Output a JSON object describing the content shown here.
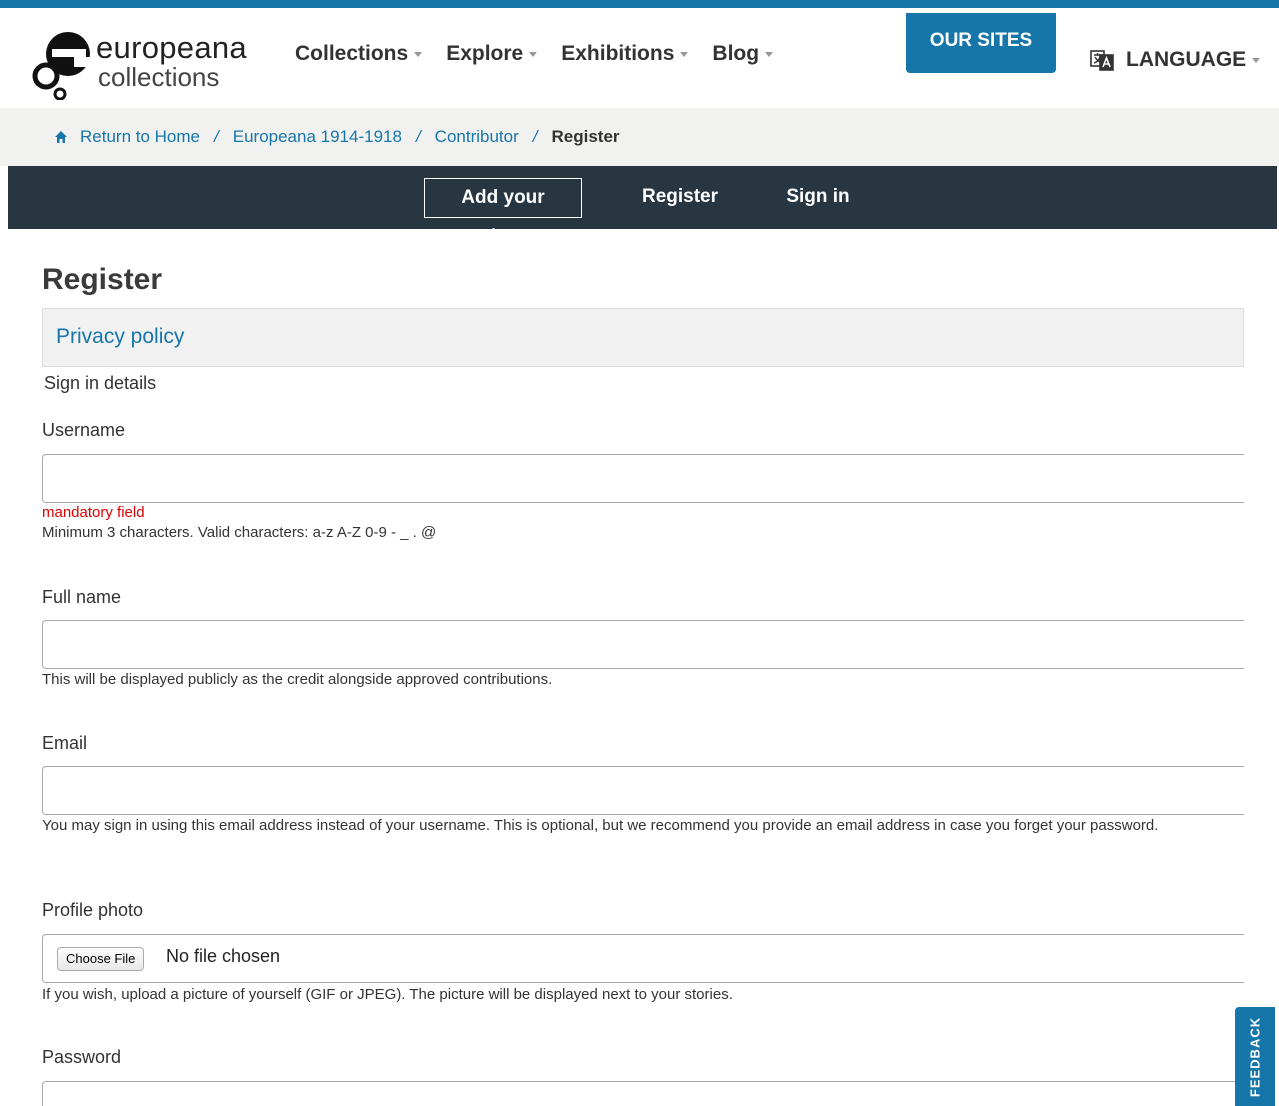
{
  "header": {
    "logo_word1": "europeana",
    "logo_word2": "collections",
    "nav": [
      "Collections",
      "Explore",
      "Exhibitions",
      "Blog"
    ],
    "our_sites": "OUR SITES",
    "language": "LANGUAGE"
  },
  "breadcrumb": {
    "items": [
      "Return to Home",
      "Europeana 1914-1918",
      "Contributor"
    ],
    "current": "Register",
    "separator": "/"
  },
  "subnav": {
    "add_story": "Add your story",
    "register": "Register",
    "sign_in": "Sign in"
  },
  "form": {
    "title": "Register",
    "privacy_policy": "Privacy policy",
    "legend": "Sign in details",
    "username": {
      "label": "Username",
      "value": "",
      "mandatory": "mandatory field",
      "help": "Minimum 3 characters. Valid characters: a-z A-Z 0-9 - _ . @"
    },
    "fullname": {
      "label": "Full name",
      "value": "",
      "help": "This will be displayed publicly as the credit alongside approved contributions."
    },
    "email": {
      "label": "Email",
      "value": "",
      "help": "You may sign in using this email address instead of your username. This is optional, but we recommend you provide an email address in case you forget your password."
    },
    "photo": {
      "label": "Profile photo",
      "button": "Choose File",
      "status": "No file chosen",
      "help": "If you wish, upload a picture of yourself (GIF or JPEG). The picture will be displayed next to your stories."
    },
    "password": {
      "label": "Password",
      "value": ""
    }
  },
  "feedback": "FEEDBACK",
  "colors": {
    "brand": "#1676aa",
    "dark": "#283641",
    "error": "#dd0000"
  }
}
